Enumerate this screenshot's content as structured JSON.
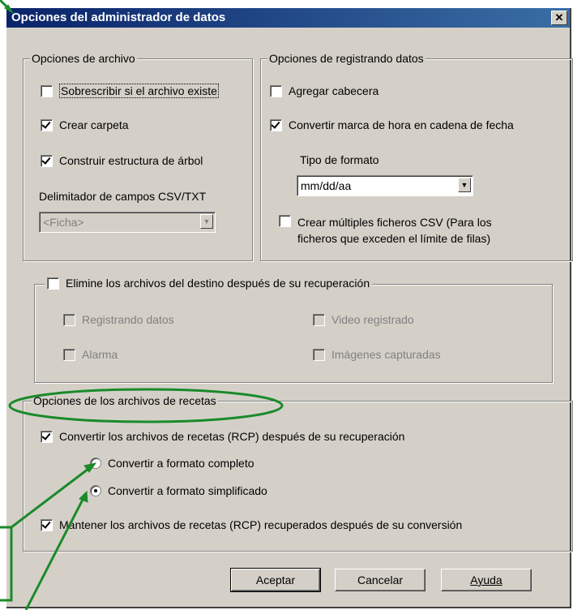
{
  "dialog": {
    "title": "Opciones del administrador de datos",
    "close_label": "✕"
  },
  "file_options": {
    "label": "Opciones de archivo",
    "overwrite": "Sobrescribir si el archivo existe",
    "create_folder": "Crear carpeta",
    "build_tree": "Construir estructura de árbol",
    "delimiter_label": "Delimitador de campos CSV/TXT",
    "delimiter_value": "<Ficha>"
  },
  "log_options": {
    "label": "Opciones de registrando datos",
    "add_header": "Agregar cabecera",
    "convert_timestamp": "Convertir marca de hora en cadena de fecha",
    "format_label": "Tipo de formato",
    "format_value": "mm/dd/aa",
    "multi_csv_line1": "Crear múltiples ficheros CSV (Para los",
    "multi_csv_line2": "ficheros que exceden el límite de filas)"
  },
  "delete_options": {
    "label": "Elimine los archivos del destino después de su recuperación",
    "data_logging": "Registrando datos",
    "video": "Video registrado",
    "alarm": "Alarma",
    "captured": "Imágenes capturadas"
  },
  "recipe_options": {
    "label": "Opciones de los archivos de recetas",
    "convert": "Convertir los archivos de recetas (RCP) después de su recuperación",
    "full_format": "Convertir a formato completo",
    "simplified_format": "Convertir a formato simplificado",
    "keep": "Mantener los archivos de recetas (RCP) recuperados después de su conversión"
  },
  "buttons": {
    "ok": "Aceptar",
    "cancel": "Cancelar",
    "help": "Ayuda"
  },
  "colors": {
    "annotation": "#1a8a2a",
    "titlebar": "#0a246a",
    "face": "#d4d0c8"
  }
}
